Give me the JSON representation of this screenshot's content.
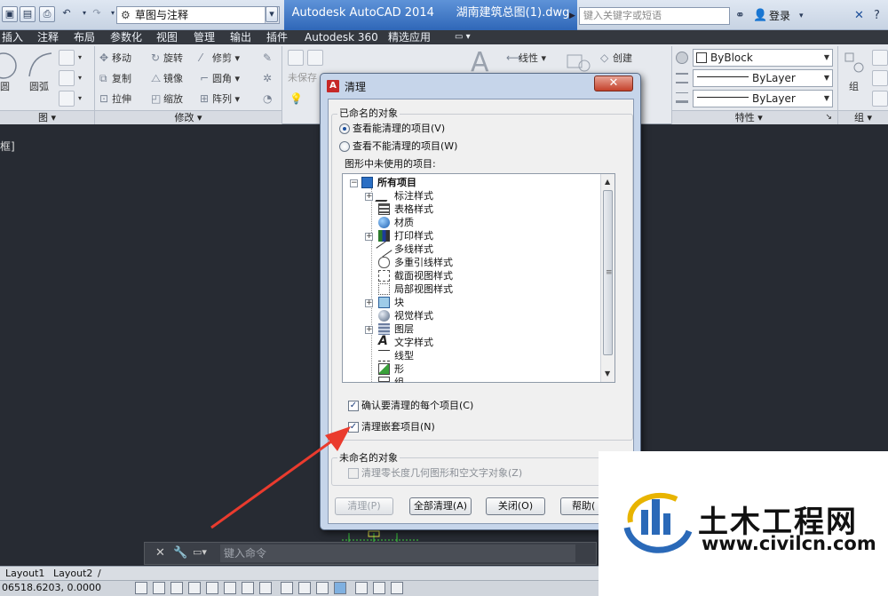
{
  "titlebar": {
    "workspace": "草图与注释",
    "app_name": "Autodesk AutoCAD 2014",
    "file_name": "湖南建筑总图(1).dwg",
    "search_placeholder": "键入关键字或短语",
    "login": "登录"
  },
  "menu": [
    "插入",
    "注释",
    "布局",
    "参数化",
    "视图",
    "管理",
    "输出",
    "插件",
    "Autodesk 360",
    "精选应用"
  ],
  "ribbon": {
    "draw_tools": [
      "圆",
      "圆弧"
    ],
    "modify_tools": [
      "移动",
      "旋转",
      "修剪",
      "复制",
      "镜像",
      "圆角",
      "拉伸",
      "缩放",
      "阵列"
    ],
    "layer_text": "未保存",
    "annotation_tools": [
      "线性",
      "创建"
    ],
    "properties": {
      "color": "ByBlock",
      "linetype": "ByLayer",
      "lineweight": "ByLayer"
    },
    "group_label": "组",
    "panels": {
      "draw": "图",
      "modify": "修改",
      "properties": "特性",
      "groups": "组"
    }
  },
  "viewport_label": "框]",
  "dialog": {
    "title": "清理",
    "named_objects_label": "已命名的对象",
    "radio_can_purge": "查看能清理的项目(V)",
    "radio_cannot_purge": "查看不能清理的项目(W)",
    "unused_label": "图形中未使用的项目:",
    "tree_root": "所有项目",
    "tree_items": [
      "标注样式",
      "表格样式",
      "材质",
      "打印样式",
      "多线样式",
      "多重引线样式",
      "截面视图样式",
      "局部视图样式",
      "块",
      "视觉样式",
      "图层",
      "文字样式",
      "线型",
      "形",
      "组"
    ],
    "confirm_each": "确认要清理的每个项目(C)",
    "purge_nested": "清理嵌套项目(N)",
    "unnamed_label": "未命名的对象",
    "zero_length": "清理零长度几何图形和空文字对象(Z)",
    "buttons": {
      "purge": "清理(P)",
      "purge_all": "全部清理(A)",
      "close": "关闭(O)",
      "help": "帮助("
    }
  },
  "command_placeholder": "键入命令",
  "layout_tabs": [
    "Layout1",
    "Layout2"
  ],
  "coords": "06518.6203, 0.0000",
  "watermark": {
    "title": "土木工程网",
    "url": "www.civilcn.com"
  }
}
